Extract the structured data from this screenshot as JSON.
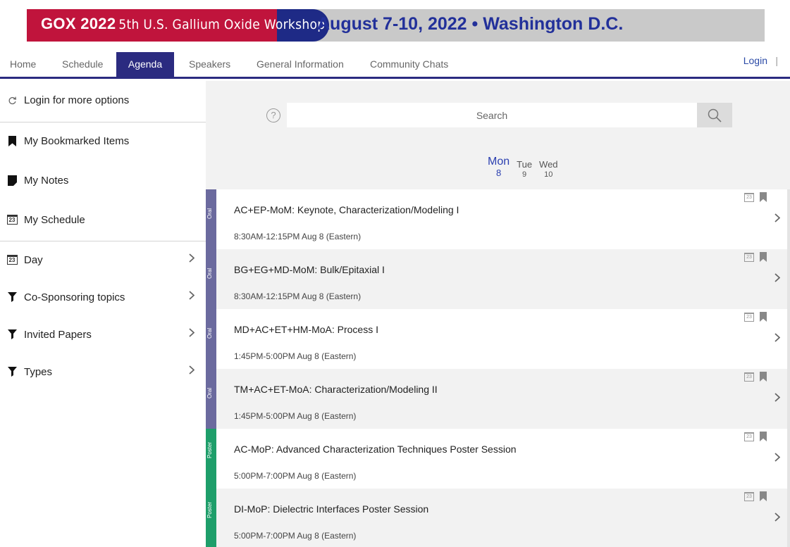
{
  "banner": {
    "title": "GOX 2022",
    "subtitle": "5th U.S. Gallium Oxide Workshop",
    "date": "August 7-10, 2022 • Washington D.C.",
    "colors": {
      "red": "#c0143c",
      "navy": "#1e2a86",
      "gray": "#c9c9c9"
    }
  },
  "nav": {
    "tabs": [
      "Home",
      "Schedule",
      "Agenda",
      "Speakers",
      "General Information",
      "Community Chats"
    ],
    "active": "Agenda",
    "login": "Login",
    "separator": "|"
  },
  "sidebar": {
    "login_options": "Login for more options",
    "bookmarked": "My Bookmarked Items",
    "notes": "My Notes",
    "schedule": "My Schedule",
    "day": "Day",
    "co_sponsoring": "Co-Sponsoring topics",
    "invited": "Invited Papers",
    "types": "Types",
    "calendar_icon_num": "23"
  },
  "search": {
    "placeholder": "Search"
  },
  "days": [
    {
      "name": "Mon",
      "num": "8"
    },
    {
      "name": "Tue",
      "num": "9"
    },
    {
      "name": "Wed",
      "num": "10"
    }
  ],
  "sessions": [
    {
      "type": "Oral",
      "color": "#6b6a9e",
      "title": "AC+EP-MoM: Keynote, Characterization/Modeling I",
      "time": "8:30AM-12:15PM Aug 8 (Eastern)"
    },
    {
      "type": "Oral",
      "color": "#6b6a9e",
      "title": "BG+EG+MD-MoM: Bulk/Epitaxial I",
      "time": "8:30AM-12:15PM Aug 8 (Eastern)"
    },
    {
      "type": "Oral",
      "color": "#6b6a9e",
      "title": "MD+AC+ET+HM-MoA: Process I",
      "time": "1:45PM-5:00PM Aug 8 (Eastern)"
    },
    {
      "type": "Oral",
      "color": "#6b6a9e",
      "title": "TM+AC+ET-MoA: Characterization/Modeling II",
      "time": "1:45PM-5:00PM Aug 8 (Eastern)"
    },
    {
      "type": "Poster",
      "color": "#1e9e6a",
      "title": "AC-MoP: Advanced Characterization Techniques Poster Session",
      "time": "5:00PM-7:00PM Aug 8 (Eastern)"
    },
    {
      "type": "Poster",
      "color": "#1e9e6a",
      "title": "DI-MoP: Dielectric Interfaces Poster Session",
      "time": "5:00PM-7:00PM Aug 8 (Eastern)"
    }
  ]
}
